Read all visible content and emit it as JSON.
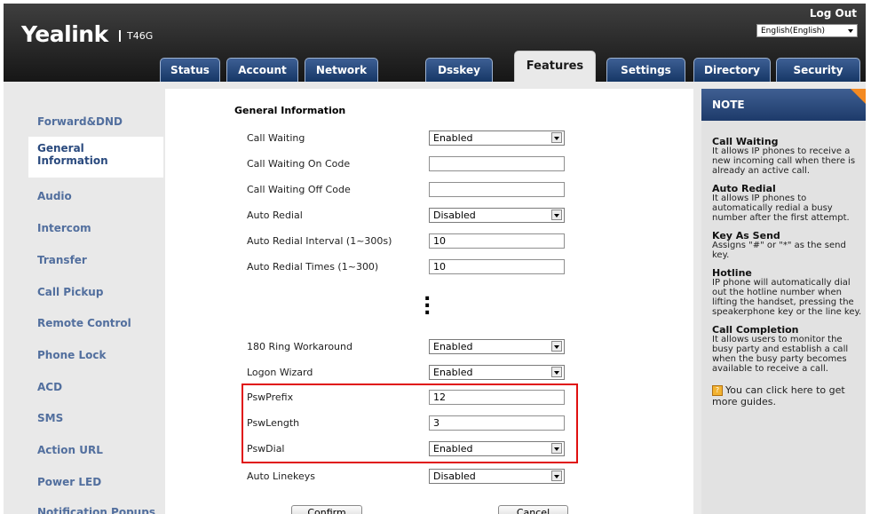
{
  "header": {
    "brand": "Yealink",
    "model": "T46G",
    "logout": "Log Out",
    "language": "English(English)"
  },
  "tabs": [
    {
      "label": "Status"
    },
    {
      "label": "Account"
    },
    {
      "label": "Network"
    },
    {
      "label": "Dsskey"
    },
    {
      "label": "Features",
      "active": true
    },
    {
      "label": "Settings"
    },
    {
      "label": "Directory"
    },
    {
      "label": "Security"
    }
  ],
  "sidebar": {
    "items": [
      {
        "label": "Forward&DND"
      },
      {
        "label": "General\nInformation",
        "active": true
      },
      {
        "label": "Audio"
      },
      {
        "label": "Intercom"
      },
      {
        "label": "Transfer"
      },
      {
        "label": "Call Pickup"
      },
      {
        "label": "Remote Control"
      },
      {
        "label": "Phone Lock"
      },
      {
        "label": "ACD"
      },
      {
        "label": "SMS"
      },
      {
        "label": "Action URL"
      },
      {
        "label": "Power LED"
      },
      {
        "label": "Notification Popups"
      }
    ]
  },
  "form": {
    "section_title": "General Information",
    "fields": [
      {
        "label": "Call Waiting",
        "type": "select",
        "value": "Enabled"
      },
      {
        "label": "Call Waiting On Code",
        "type": "input",
        "value": ""
      },
      {
        "label": "Call Waiting Off Code",
        "type": "input",
        "value": ""
      },
      {
        "label": "Auto Redial",
        "type": "select",
        "value": "Disabled"
      },
      {
        "label": "Auto Redial Interval (1~300s)",
        "type": "input",
        "value": "10"
      },
      {
        "label": "Auto Redial Times (1~300)",
        "type": "input",
        "value": "10"
      },
      {
        "label": "180 Ring Workaround",
        "type": "select",
        "value": "Enabled"
      },
      {
        "label": "Logon Wizard",
        "type": "select",
        "value": "Enabled"
      },
      {
        "label": "PswPrefix",
        "type": "input",
        "value": "12"
      },
      {
        "label": "PswLength",
        "type": "input",
        "value": "3"
      },
      {
        "label": "PswDial",
        "type": "select",
        "value": "Enabled"
      },
      {
        "label": "Auto Linekeys",
        "type": "select",
        "value": "Disabled"
      }
    ],
    "confirm_label": "Confirm",
    "cancel_label": "Cancel"
  },
  "note": {
    "title": "NOTE",
    "entries": [
      {
        "title": "Call Waiting",
        "text": "It allows IP phones to receive a new incoming call when there is already an active call."
      },
      {
        "title": "Auto Redial",
        "text": "It allows IP phones to automatically redial a busy number after the first attempt."
      },
      {
        "title": "Key As Send",
        "text": "Assigns \"#\" or \"*\" as the send key."
      },
      {
        "title": "Hotline",
        "text": "IP phone will automatically dial out the hotline number when lifting the handset, pressing the speakerphone key or the line key."
      },
      {
        "title": "Call Completion",
        "text": "It allows users to monitor the busy party and establish a call when the busy party becomes available to receive a call."
      }
    ],
    "guide_text": "You can click here to get more guides."
  },
  "colors": {
    "header_dark": "#1c1c1c",
    "tab_blue": "#1d3a6a",
    "sidebar_text": "#526f9e",
    "highlight_red": "#e01010",
    "note_corner": "#f48a22"
  }
}
